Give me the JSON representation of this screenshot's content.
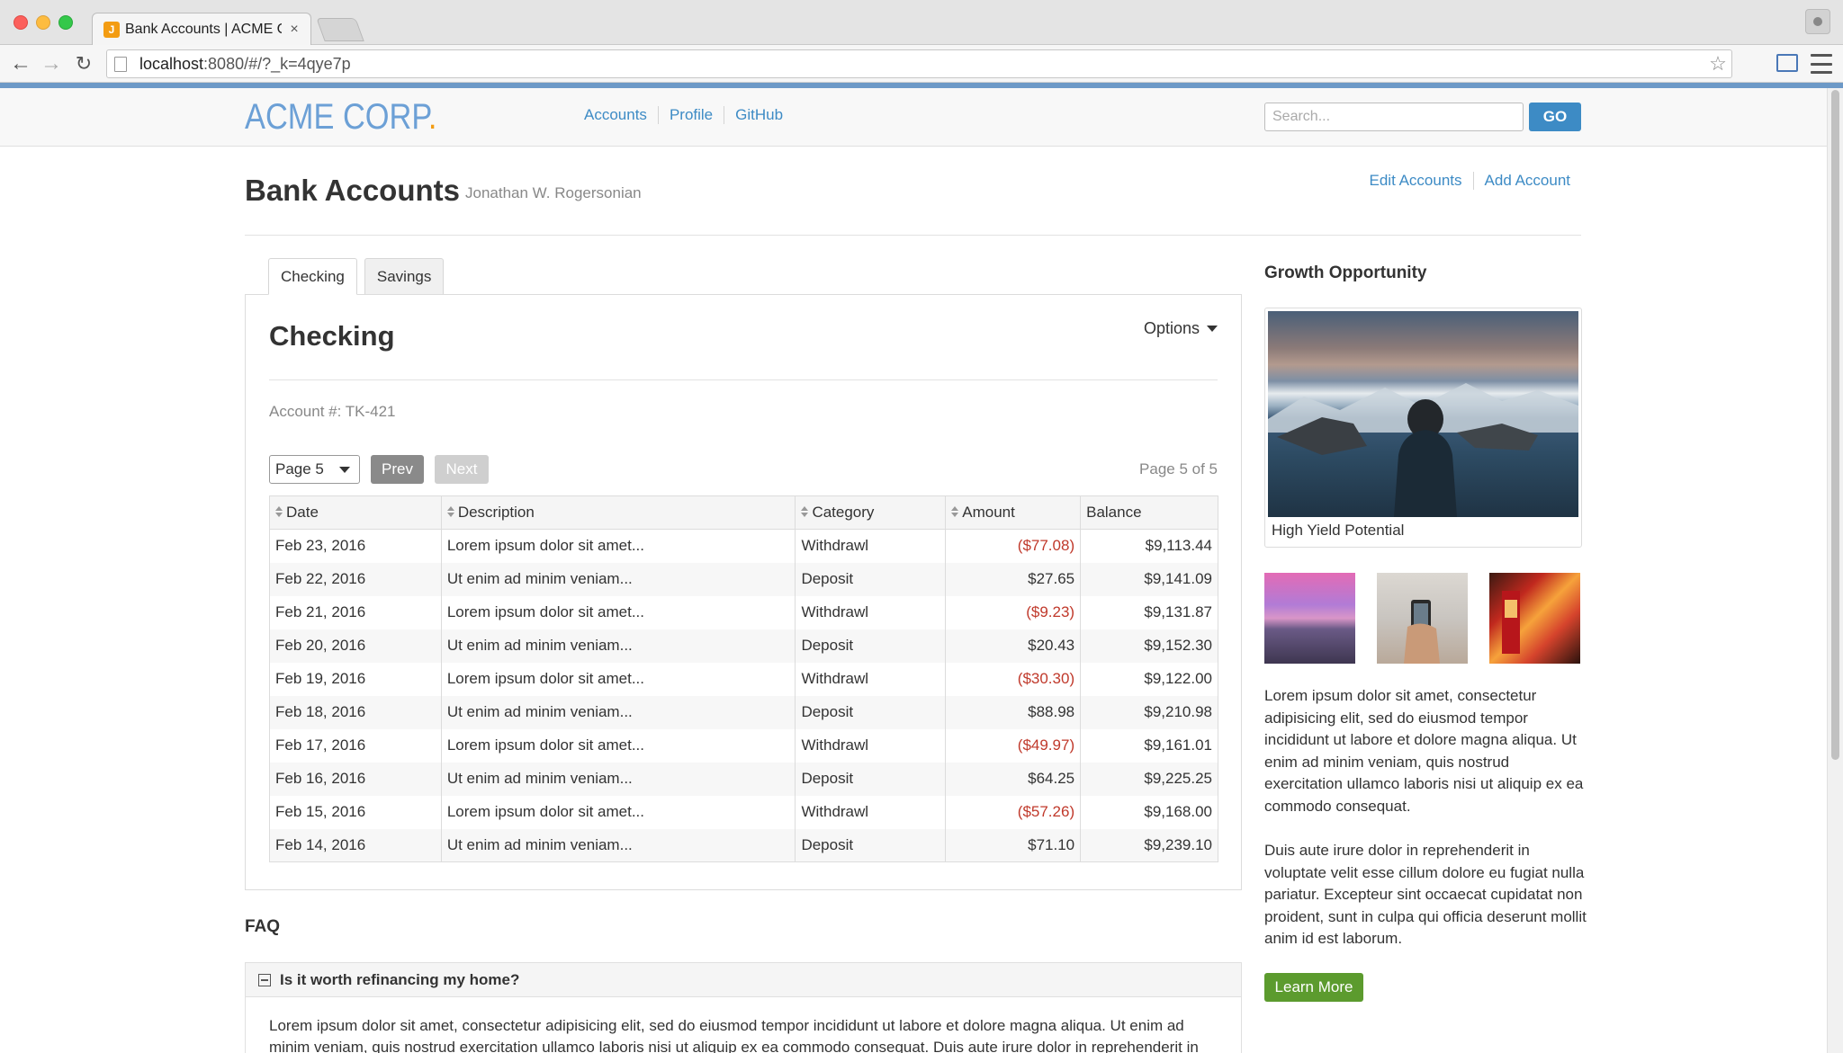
{
  "browser": {
    "tab_title": "Bank Accounts | ACME Cor",
    "tab_favicon": "J",
    "url_host": "localhost",
    "url_rest": ":8080/#/?_k=4qye7p"
  },
  "header": {
    "logo_text": "ACME CORP",
    "logo_dot": ".",
    "nav": [
      "Accounts",
      "Profile",
      "GitHub"
    ],
    "search_placeholder": "Search...",
    "go_label": "GO"
  },
  "title": {
    "heading": "Bank Accounts",
    "subtitle": "Jonathan W. Rogersonian",
    "actions": [
      "Edit Accounts",
      "Add Account"
    ]
  },
  "account_tabs": [
    "Checking",
    "Savings"
  ],
  "panel": {
    "title": "Checking",
    "options_label": "Options",
    "account_number": "Account #: TK-421",
    "page_select": "Page 5",
    "prev_label": "Prev",
    "next_label": "Next",
    "page_of": "Page 5 of 5"
  },
  "table": {
    "columns": [
      "Date",
      "Description",
      "Category",
      "Amount",
      "Balance"
    ],
    "rows": [
      [
        "Feb 23, 2016",
        "Lorem ipsum dolor sit amet...",
        "Withdrawl",
        "($77.08)",
        "$9,113.44"
      ],
      [
        "Feb 22, 2016",
        "Ut enim ad minim veniam...",
        "Deposit",
        "$27.65",
        "$9,141.09"
      ],
      [
        "Feb 21, 2016",
        "Lorem ipsum dolor sit amet...",
        "Withdrawl",
        "($9.23)",
        "$9,131.87"
      ],
      [
        "Feb 20, 2016",
        "Ut enim ad minim veniam...",
        "Deposit",
        "$20.43",
        "$9,152.30"
      ],
      [
        "Feb 19, 2016",
        "Lorem ipsum dolor sit amet...",
        "Withdrawl",
        "($30.30)",
        "$9,122.00"
      ],
      [
        "Feb 18, 2016",
        "Ut enim ad minim veniam...",
        "Deposit",
        "$88.98",
        "$9,210.98"
      ],
      [
        "Feb 17, 2016",
        "Lorem ipsum dolor sit amet...",
        "Withdrawl",
        "($49.97)",
        "$9,161.01"
      ],
      [
        "Feb 16, 2016",
        "Ut enim ad minim veniam...",
        "Deposit",
        "$64.25",
        "$9,225.25"
      ],
      [
        "Feb 15, 2016",
        "Lorem ipsum dolor sit amet...",
        "Withdrawl",
        "($57.26)",
        "$9,168.00"
      ],
      [
        "Feb 14, 2016",
        "Ut enim ad minim veniam...",
        "Deposit",
        "$71.10",
        "$9,239.10"
      ]
    ]
  },
  "faq": {
    "title": "FAQ",
    "question": "Is it worth refinancing my home?",
    "answer": "Lorem ipsum dolor sit amet, consectetur adipisicing elit, sed do eiusmod tempor incididunt ut labore et dolore magna aliqua. Ut enim ad minim veniam, quis nostrud exercitation ullamco laboris nisi ut aliquip ex ea commodo consequat. Duis aute irure dolor in reprehenderit in"
  },
  "sidebar": {
    "title": "Growth Opportunity",
    "feature_caption": "High Yield Potential",
    "paragraph1": "Lorem ipsum dolor sit amet, consectetur adipisicing elit, sed do eiusmod tempor incididunt ut labore et dolore magna aliqua. Ut enim ad minim veniam, quis nostrud exercitation ullamco laboris nisi ut aliquip ex ea commodo consequat.",
    "paragraph2": "Duis aute irure dolor in reprehenderit in voluptate velit esse cillum dolore eu fugiat nulla pariatur. Excepteur sint occaecat cupidatat non proident, sunt in culpa qui officia deserunt mollit anim id est laborum.",
    "learn_more": "Learn More"
  },
  "colors": {
    "accent": "#3d8bc5",
    "negative": "#c0392b",
    "learn_more": "#5c9b2e",
    "logo_dot": "#f39c12"
  }
}
